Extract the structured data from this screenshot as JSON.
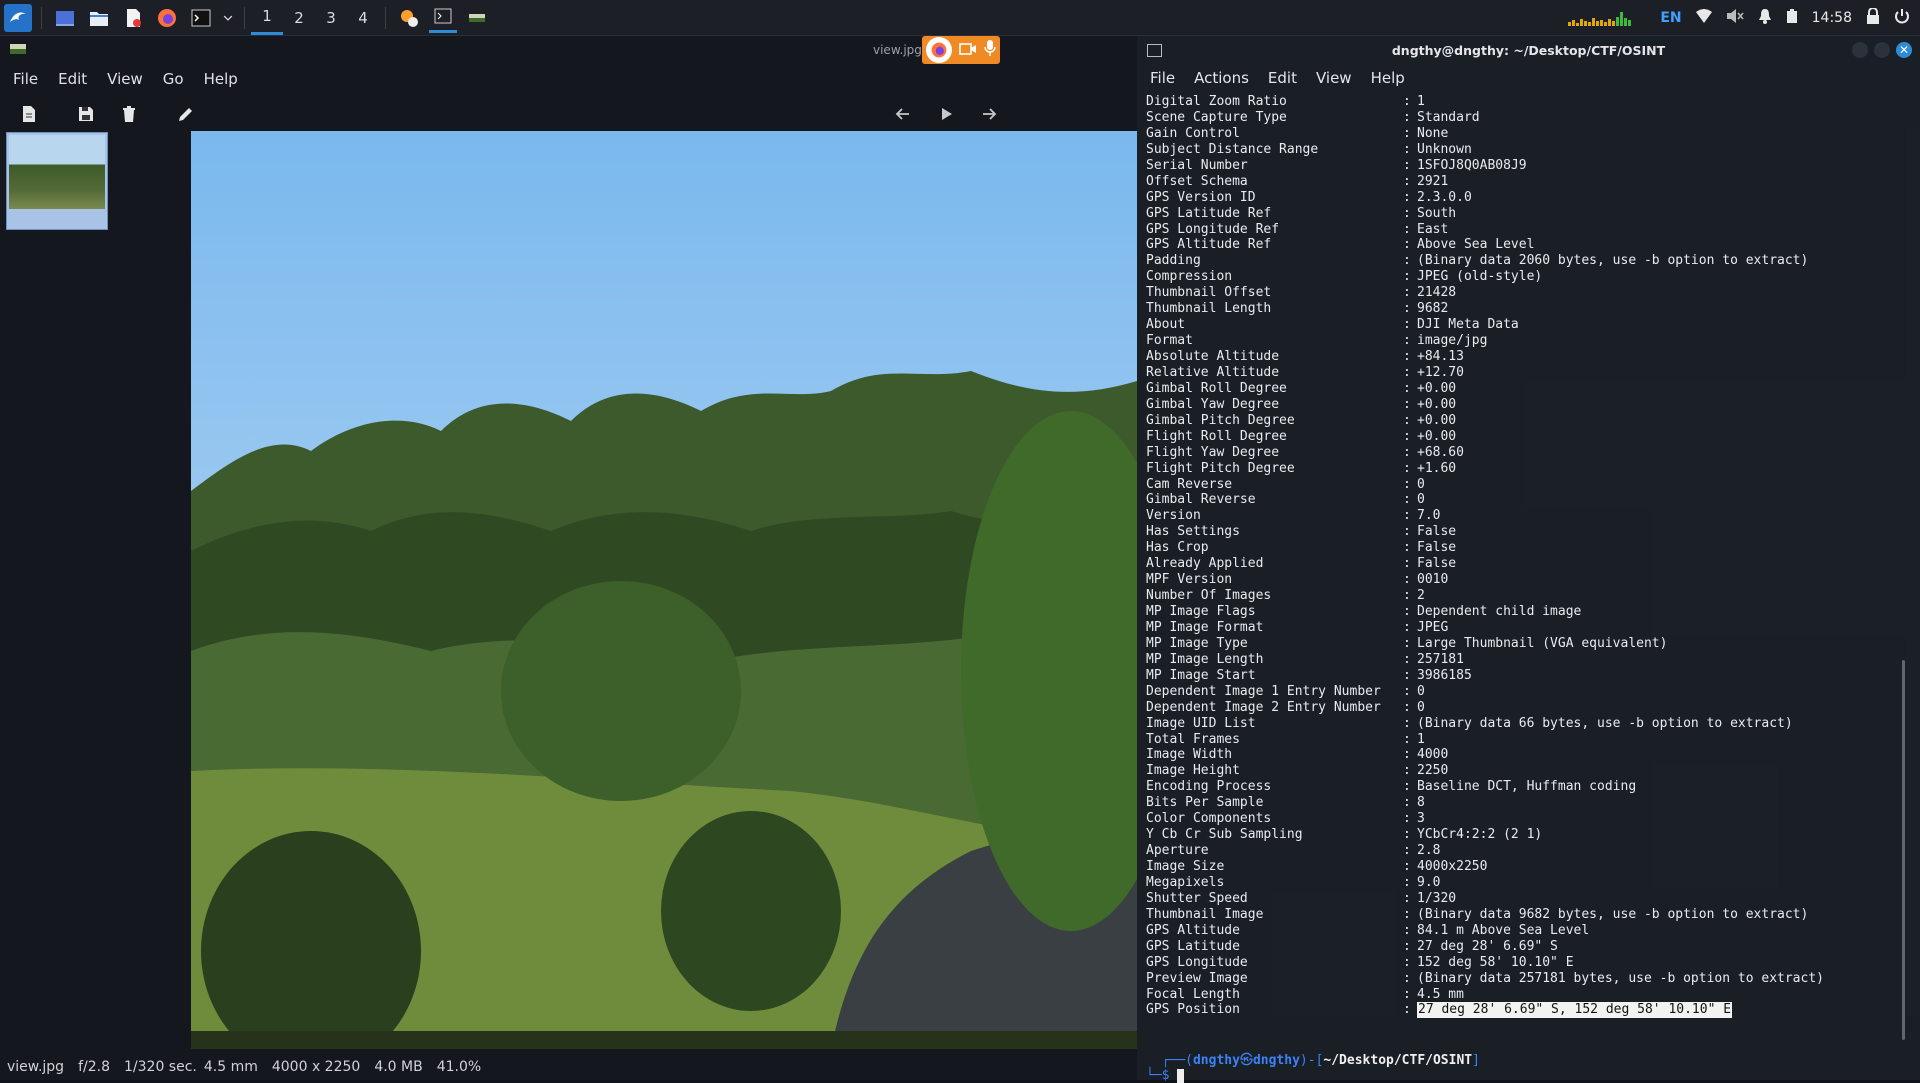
{
  "taskbar": {
    "workspaces": [
      "1",
      "2",
      "3",
      "4"
    ],
    "active_workspace": "1",
    "tray": {
      "language": "EN",
      "clock": "14:58"
    },
    "colors": {
      "accent": "#2e8bd8",
      "lang": "#3fa0ff"
    }
  },
  "viewer": {
    "window_title": "view.jpg",
    "menu": [
      "File",
      "Edit",
      "View",
      "Go",
      "Help"
    ],
    "status": {
      "filename": "view.jpg",
      "aperture": "f/2.8",
      "exposure": "1/320 sec.",
      "focal": "4.5 mm",
      "dimensions": "4000 x 2250",
      "size": "4.0 MB",
      "zoom": "41.0%"
    }
  },
  "terminal": {
    "title": "dngthy@dngthy: ~/Desktop/CTF/OSINT",
    "menu": [
      "File",
      "Actions",
      "Edit",
      "View",
      "Help"
    ],
    "rows": [
      {
        "k": "Digital Zoom Ratio",
        "v": "1"
      },
      {
        "k": "Scene Capture Type",
        "v": "Standard"
      },
      {
        "k": "Gain Control",
        "v": "None"
      },
      {
        "k": "Subject Distance Range",
        "v": "Unknown"
      },
      {
        "k": "Serial Number",
        "v": "1SFOJ8Q0AB08J9"
      },
      {
        "k": "Offset Schema",
        "v": "2921"
      },
      {
        "k": "GPS Version ID",
        "v": "2.3.0.0"
      },
      {
        "k": "GPS Latitude Ref",
        "v": "South"
      },
      {
        "k": "GPS Longitude Ref",
        "v": "East"
      },
      {
        "k": "GPS Altitude Ref",
        "v": "Above Sea Level"
      },
      {
        "k": "Padding",
        "v": "(Binary data 2060 bytes, use -b option to extract)"
      },
      {
        "k": "Compression",
        "v": "JPEG (old-style)"
      },
      {
        "k": "Thumbnail Offset",
        "v": "21428"
      },
      {
        "k": "Thumbnail Length",
        "v": "9682"
      },
      {
        "k": "About",
        "v": "DJI Meta Data"
      },
      {
        "k": "Format",
        "v": "image/jpg"
      },
      {
        "k": "Absolute Altitude",
        "v": "+84.13"
      },
      {
        "k": "Relative Altitude",
        "v": "+12.70"
      },
      {
        "k": "Gimbal Roll Degree",
        "v": "+0.00"
      },
      {
        "k": "Gimbal Yaw Degree",
        "v": "+0.00"
      },
      {
        "k": "Gimbal Pitch Degree",
        "v": "+0.00"
      },
      {
        "k": "Flight Roll Degree",
        "v": "+0.00"
      },
      {
        "k": "Flight Yaw Degree",
        "v": "+68.60"
      },
      {
        "k": "Flight Pitch Degree",
        "v": "+1.60"
      },
      {
        "k": "Cam Reverse",
        "v": "0"
      },
      {
        "k": "Gimbal Reverse",
        "v": "0"
      },
      {
        "k": "Version",
        "v": "7.0"
      },
      {
        "k": "Has Settings",
        "v": "False"
      },
      {
        "k": "Has Crop",
        "v": "False"
      },
      {
        "k": "Already Applied",
        "v": "False"
      },
      {
        "k": "MPF Version",
        "v": "0010"
      },
      {
        "k": "Number Of Images",
        "v": "2"
      },
      {
        "k": "MP Image Flags",
        "v": "Dependent child image"
      },
      {
        "k": "MP Image Format",
        "v": "JPEG"
      },
      {
        "k": "MP Image Type",
        "v": "Large Thumbnail (VGA equivalent)"
      },
      {
        "k": "MP Image Length",
        "v": "257181"
      },
      {
        "k": "MP Image Start",
        "v": "3986185"
      },
      {
        "k": "Dependent Image 1 Entry Number",
        "v": "0"
      },
      {
        "k": "Dependent Image 2 Entry Number",
        "v": "0"
      },
      {
        "k": "Image UID List",
        "v": "(Binary data 66 bytes, use -b option to extract)"
      },
      {
        "k": "Total Frames",
        "v": "1"
      },
      {
        "k": "Image Width",
        "v": "4000"
      },
      {
        "k": "Image Height",
        "v": "2250"
      },
      {
        "k": "Encoding Process",
        "v": "Baseline DCT, Huffman coding"
      },
      {
        "k": "Bits Per Sample",
        "v": "8"
      },
      {
        "k": "Color Components",
        "v": "3"
      },
      {
        "k": "Y Cb Cr Sub Sampling",
        "v": "YCbCr4:2:2 (2 1)"
      },
      {
        "k": "Aperture",
        "v": "2.8"
      },
      {
        "k": "Image Size",
        "v": "4000x2250"
      },
      {
        "k": "Megapixels",
        "v": "9.0"
      },
      {
        "k": "Shutter Speed",
        "v": "1/320"
      },
      {
        "k": "Thumbnail Image",
        "v": "(Binary data 9682 bytes, use -b option to extract)"
      },
      {
        "k": "GPS Altitude",
        "v": "84.1 m Above Sea Level"
      },
      {
        "k": "GPS Latitude",
        "v": "27 deg 28' 6.69\" S"
      },
      {
        "k": "GPS Longitude",
        "v": "152 deg 58' 10.10\" E"
      },
      {
        "k": "Preview Image",
        "v": "(Binary data 257181 bytes, use -b option to extract)"
      },
      {
        "k": "Focal Length",
        "v": "4.5 mm"
      },
      {
        "k": "GPS Position",
        "v": "27 deg 28' 6.69\" S, 152 deg 58' 10.10\" E",
        "highlight": true
      }
    ],
    "prompt": {
      "user": "dngthy",
      "host": "dngthy",
      "path": "~/Desktop/CTF/OSINT",
      "symbol": "$"
    }
  }
}
